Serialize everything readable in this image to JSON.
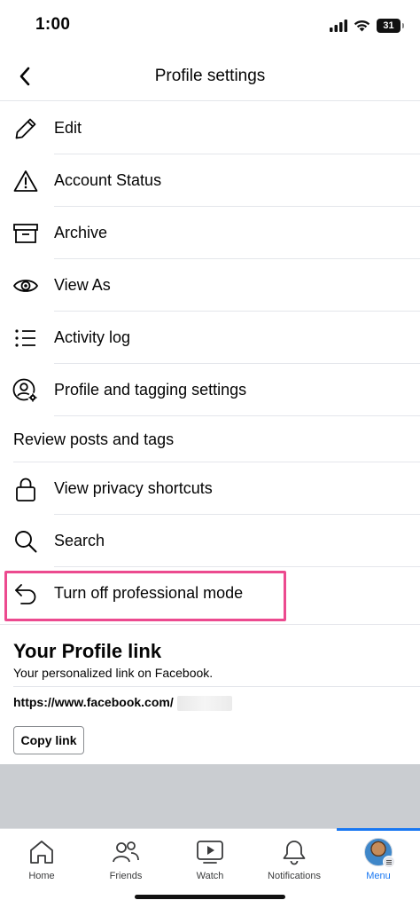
{
  "status": {
    "time": "1:00",
    "battery": "31"
  },
  "header": {
    "title": "Profile settings"
  },
  "items": [
    {
      "label": "Edit",
      "icon": "pencil-icon"
    },
    {
      "label": "Account Status",
      "icon": "warning-icon"
    },
    {
      "label": "Archive",
      "icon": "archive-box-icon"
    },
    {
      "label": "View As",
      "icon": "eye-icon"
    },
    {
      "label": "Activity log",
      "icon": "list-icon"
    },
    {
      "label": "Profile and tagging settings",
      "icon": "user-gear-icon"
    },
    {
      "label": "Review posts and tags",
      "icon": ""
    },
    {
      "label": "View privacy shortcuts",
      "icon": "lock-icon"
    },
    {
      "label": "Search",
      "icon": "search-icon"
    },
    {
      "label": "Turn off professional mode",
      "icon": "undo-arrow-icon"
    }
  ],
  "profile_link": {
    "title": "Your Profile link",
    "subtitle": "Your personalized link on Facebook.",
    "url": "https://www.facebook.com/",
    "copy_label": "Copy link"
  },
  "tabs": [
    {
      "label": "Home",
      "icon": "home-icon"
    },
    {
      "label": "Friends",
      "icon": "friends-icon"
    },
    {
      "label": "Watch",
      "icon": "watch-icon"
    },
    {
      "label": "Notifications",
      "icon": "bell-icon"
    },
    {
      "label": "Menu",
      "icon": "avatar",
      "active": true
    }
  ],
  "colors": {
    "accent": "#1877f2",
    "highlight": "#ec4a8f",
    "divider": "#e4e6eb",
    "band": "#cacdd1"
  }
}
